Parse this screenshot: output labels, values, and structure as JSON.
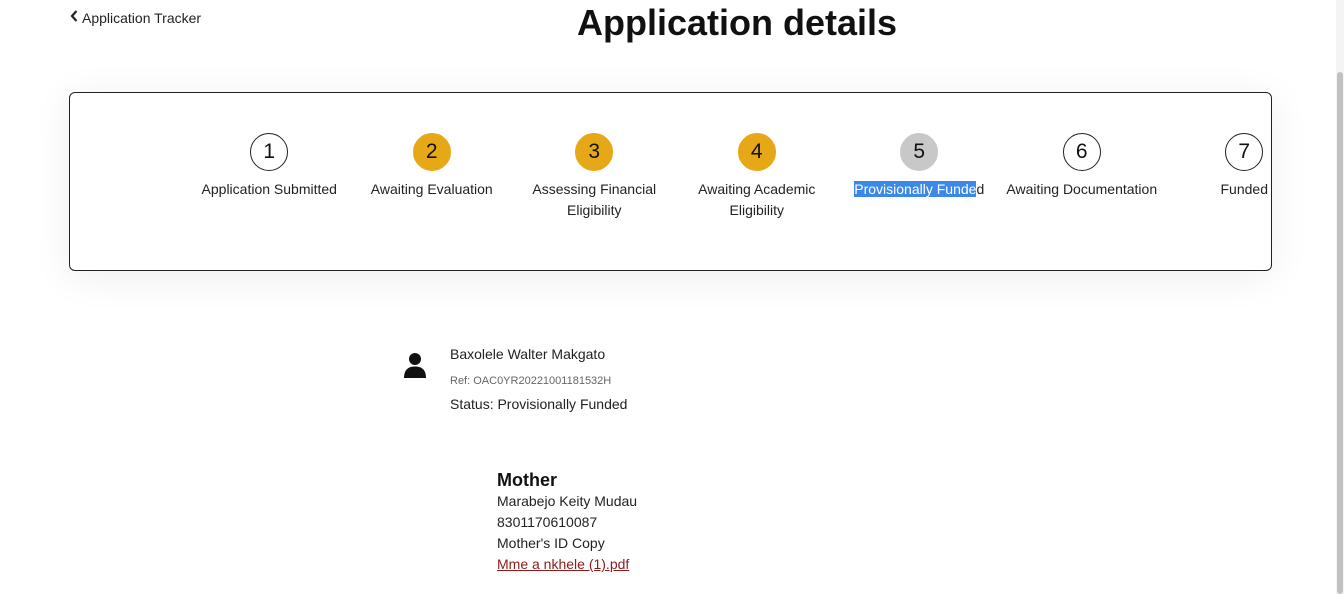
{
  "header": {
    "back_label": "Application Tracker",
    "title": "Application details"
  },
  "tracker": {
    "steps": [
      {
        "number": "1",
        "label": "Application Submitted",
        "state": "pending"
      },
      {
        "number": "2",
        "label": "Awaiting Evaluation",
        "state": "done"
      },
      {
        "number": "3",
        "label": "Assessing Financial\nEligibility",
        "state": "done"
      },
      {
        "number": "4",
        "label": "Awaiting Academic\nEligibility",
        "state": "done"
      },
      {
        "number": "5",
        "label_selected": "Provisionally Funde",
        "label_rest": "d",
        "state": "current"
      },
      {
        "number": "6",
        "label": "Awaiting Documentation",
        "state": "pending"
      },
      {
        "number": "7",
        "label": "Funded",
        "state": "pending"
      }
    ],
    "colors": {
      "done": "#e6a817",
      "current": "#c8c8c8",
      "selection": "#3b88e8"
    }
  },
  "applicant": {
    "icon": "user-icon",
    "name": "Baxolele Walter Makgato",
    "ref": "Ref: OAC0YR20221001181532H",
    "status": "Status: Provisionally Funded"
  },
  "guardian": {
    "heading": "Mother",
    "name": "Marabejo Keity Mudau",
    "id_number": "8301170610087",
    "document_label": "Mother's ID Copy",
    "document_link": "Mme a nkhele (1).pdf",
    "link_color": "#8b1c1c"
  }
}
